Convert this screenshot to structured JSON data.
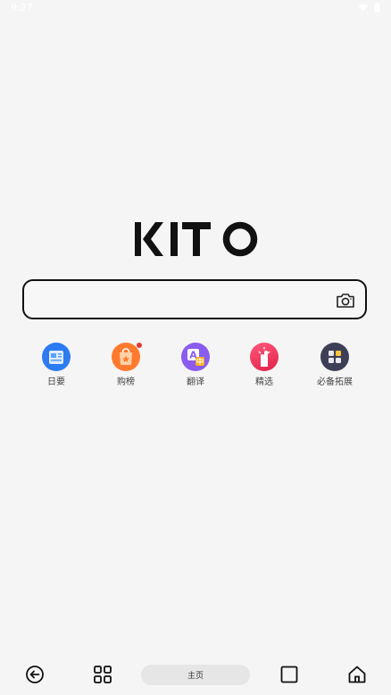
{
  "status": {
    "time": "9:27"
  },
  "logo": {
    "text": "KITO"
  },
  "search": {
    "placeholder": "",
    "value": ""
  },
  "shortcuts": [
    {
      "label": "日要",
      "icon": "news-icon",
      "color": "#2c7bf0"
    },
    {
      "label": "购榜",
      "icon": "shopping-bag-icon",
      "color": "#ff7a2f",
      "badge_color": "#e53935"
    },
    {
      "label": "翻译",
      "icon": "translate-icon",
      "color": "#8a5cf0"
    },
    {
      "label": "精选",
      "icon": "hand-pick-icon",
      "color": "#ff3d6a"
    },
    {
      "label": "必备拓展",
      "icon": "extensions-grid-icon",
      "color": "#3c3f55"
    }
  ],
  "bottom_nav": {
    "home_label": "主页"
  }
}
